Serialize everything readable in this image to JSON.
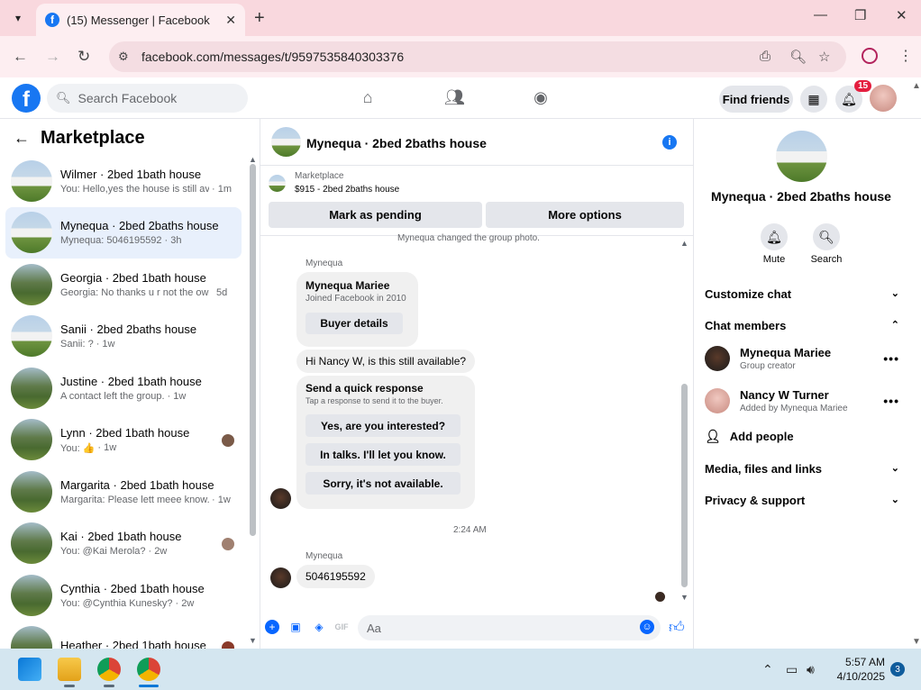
{
  "browser": {
    "tab_title": "(15) Messenger | Facebook",
    "url": "facebook.com/messages/t/9597535840303376",
    "new_tab_symbol": "+",
    "close_symbol": "✕"
  },
  "fb_header": {
    "search_placeholder": "Search Facebook",
    "find_friends": "Find friends",
    "notification_count": "15"
  },
  "left_panel": {
    "title": "Marketplace",
    "conversations": [
      {
        "name": "Wilmer · 2bed 1bath house",
        "preview": "You: Hello,yes the house is still av...",
        "time": "· 1m"
      },
      {
        "name": "Mynequa · 2bed 2baths house",
        "preview": "Mynequa: 5046195592",
        "time": "· 3h"
      },
      {
        "name": "Georgia · 2bed 1bath house",
        "preview": "Georgia: No thanks u r not the ow...",
        "time": "5d"
      },
      {
        "name": "Sanii · 2bed 2baths house",
        "preview": "Sanii: ?",
        "time": "· 1w"
      },
      {
        "name": "Justine · 2bed 1bath house",
        "preview": "A contact left the group.",
        "time": "· 1w"
      },
      {
        "name": "Lynn · 2bed 1bath house",
        "preview": "You: 👍",
        "time": "· 1w"
      },
      {
        "name": "Margarita · 2bed 1bath house",
        "preview": "Margarita: Please lett meee know...",
        "time": "· 1w"
      },
      {
        "name": "Kai · 2bed 1bath house",
        "preview": "You: @Kai Merola?",
        "time": "· 2w"
      },
      {
        "name": "Cynthia · 2bed 1bath house",
        "preview": "You: @Cynthia Kunesky?",
        "time": "· 2w"
      },
      {
        "name": "Heather · 2bed 1bath house",
        "preview": "",
        "time": ""
      }
    ]
  },
  "chat": {
    "title": "Mynequa · 2bed 2baths house",
    "marketplace_label": "Marketplace",
    "listing": "$915 - 2bed 2baths house",
    "mark_pending": "Mark as pending",
    "more_options": "More options",
    "system_message": "Mynequa changed the group photo.",
    "sender_name": "Mynequa",
    "profile_card": {
      "name": "Mynequa Mariee",
      "joined": "Joined Facebook in 2010",
      "button": "Buyer details"
    },
    "message_1": "Hi Nancy W, is this still available?",
    "quick_response": {
      "title": "Send a quick response",
      "subtitle": "Tap a response to send it to the buyer.",
      "options": [
        "Yes, are you interested?",
        "In talks. I'll let you know.",
        "Sorry, it's not available."
      ]
    },
    "timestamp": "2:24 AM",
    "sender_name_2": "Mynequa",
    "message_2": "5046195592",
    "composer_placeholder": "Aa"
  },
  "right_panel": {
    "name": "Mynequa · 2bed 2baths house",
    "mute": "Mute",
    "search": "Search",
    "customize_chat": "Customize chat",
    "chat_members": "Chat members",
    "members": [
      {
        "name": "Mynequa Mariee",
        "role": "Group creator"
      },
      {
        "name": "Nancy W Turner",
        "role": "Added by Mynequa Mariee"
      }
    ],
    "add_people": "Add people",
    "media": "Media, files and links",
    "privacy": "Privacy & support"
  },
  "taskbar": {
    "time": "5:57 AM",
    "date": "4/10/2025",
    "notification_count": "3"
  },
  "colors": {
    "facebook_blue": "#1877f2",
    "messenger_blue": "#0866ff",
    "notification_red": "#e41e3f",
    "active_conversation_bg": "#e8f0fc"
  }
}
